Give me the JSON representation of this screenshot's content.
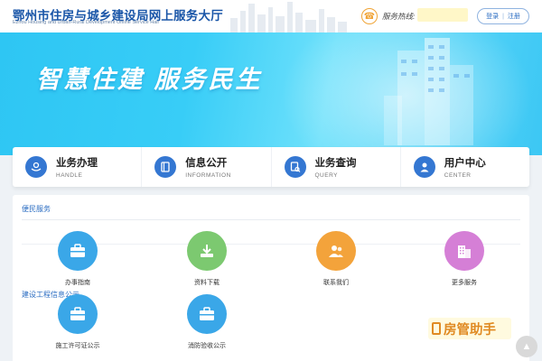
{
  "header": {
    "title": "鄂州市住房与城乡建设局网上服务大厅",
    "subtitle": "Ezhou Housing and Urban-Rural  Development Online Service Hall",
    "hotline_label": "服务热线:",
    "login": "登录",
    "register": "注册",
    "separator": "|"
  },
  "banner": {
    "slogan": "智慧住建  服务民生"
  },
  "nav": [
    {
      "label": "业务办理",
      "sub": "HANDLE",
      "icon": "hand-heart-icon"
    },
    {
      "label": "信息公开",
      "sub": "INFORMATION",
      "icon": "book-icon"
    },
    {
      "label": "业务查询",
      "sub": "QUERY",
      "icon": "document-search-icon"
    },
    {
      "label": "用户中心",
      "sub": "CENTER",
      "icon": "user-icon"
    }
  ],
  "services": {
    "title": "便民服务",
    "items": [
      {
        "label": "办事指南",
        "color": "#3aa7e8",
        "icon": "briefcase-icon"
      },
      {
        "label": "资料下载",
        "color": "#7cc970",
        "icon": "download-icon"
      },
      {
        "label": "联系我们",
        "color": "#f3a33b",
        "icon": "contacts-icon"
      },
      {
        "label": "更多服务",
        "color": "#d57fd6",
        "icon": "building-icon"
      }
    ]
  },
  "construction": {
    "title": "建设工程信息公示",
    "items": [
      {
        "label": "施工许可证公示",
        "color": "#3aa7e8",
        "icon": "briefcase-icon"
      },
      {
        "label": "消防验收公示",
        "color": "#3aa7e8",
        "icon": "briefcase-icon"
      }
    ]
  },
  "watermark": "房管助手",
  "colors": {
    "primary": "#3477d2",
    "banner": "#38cdf7",
    "accent": "#f0a437"
  }
}
